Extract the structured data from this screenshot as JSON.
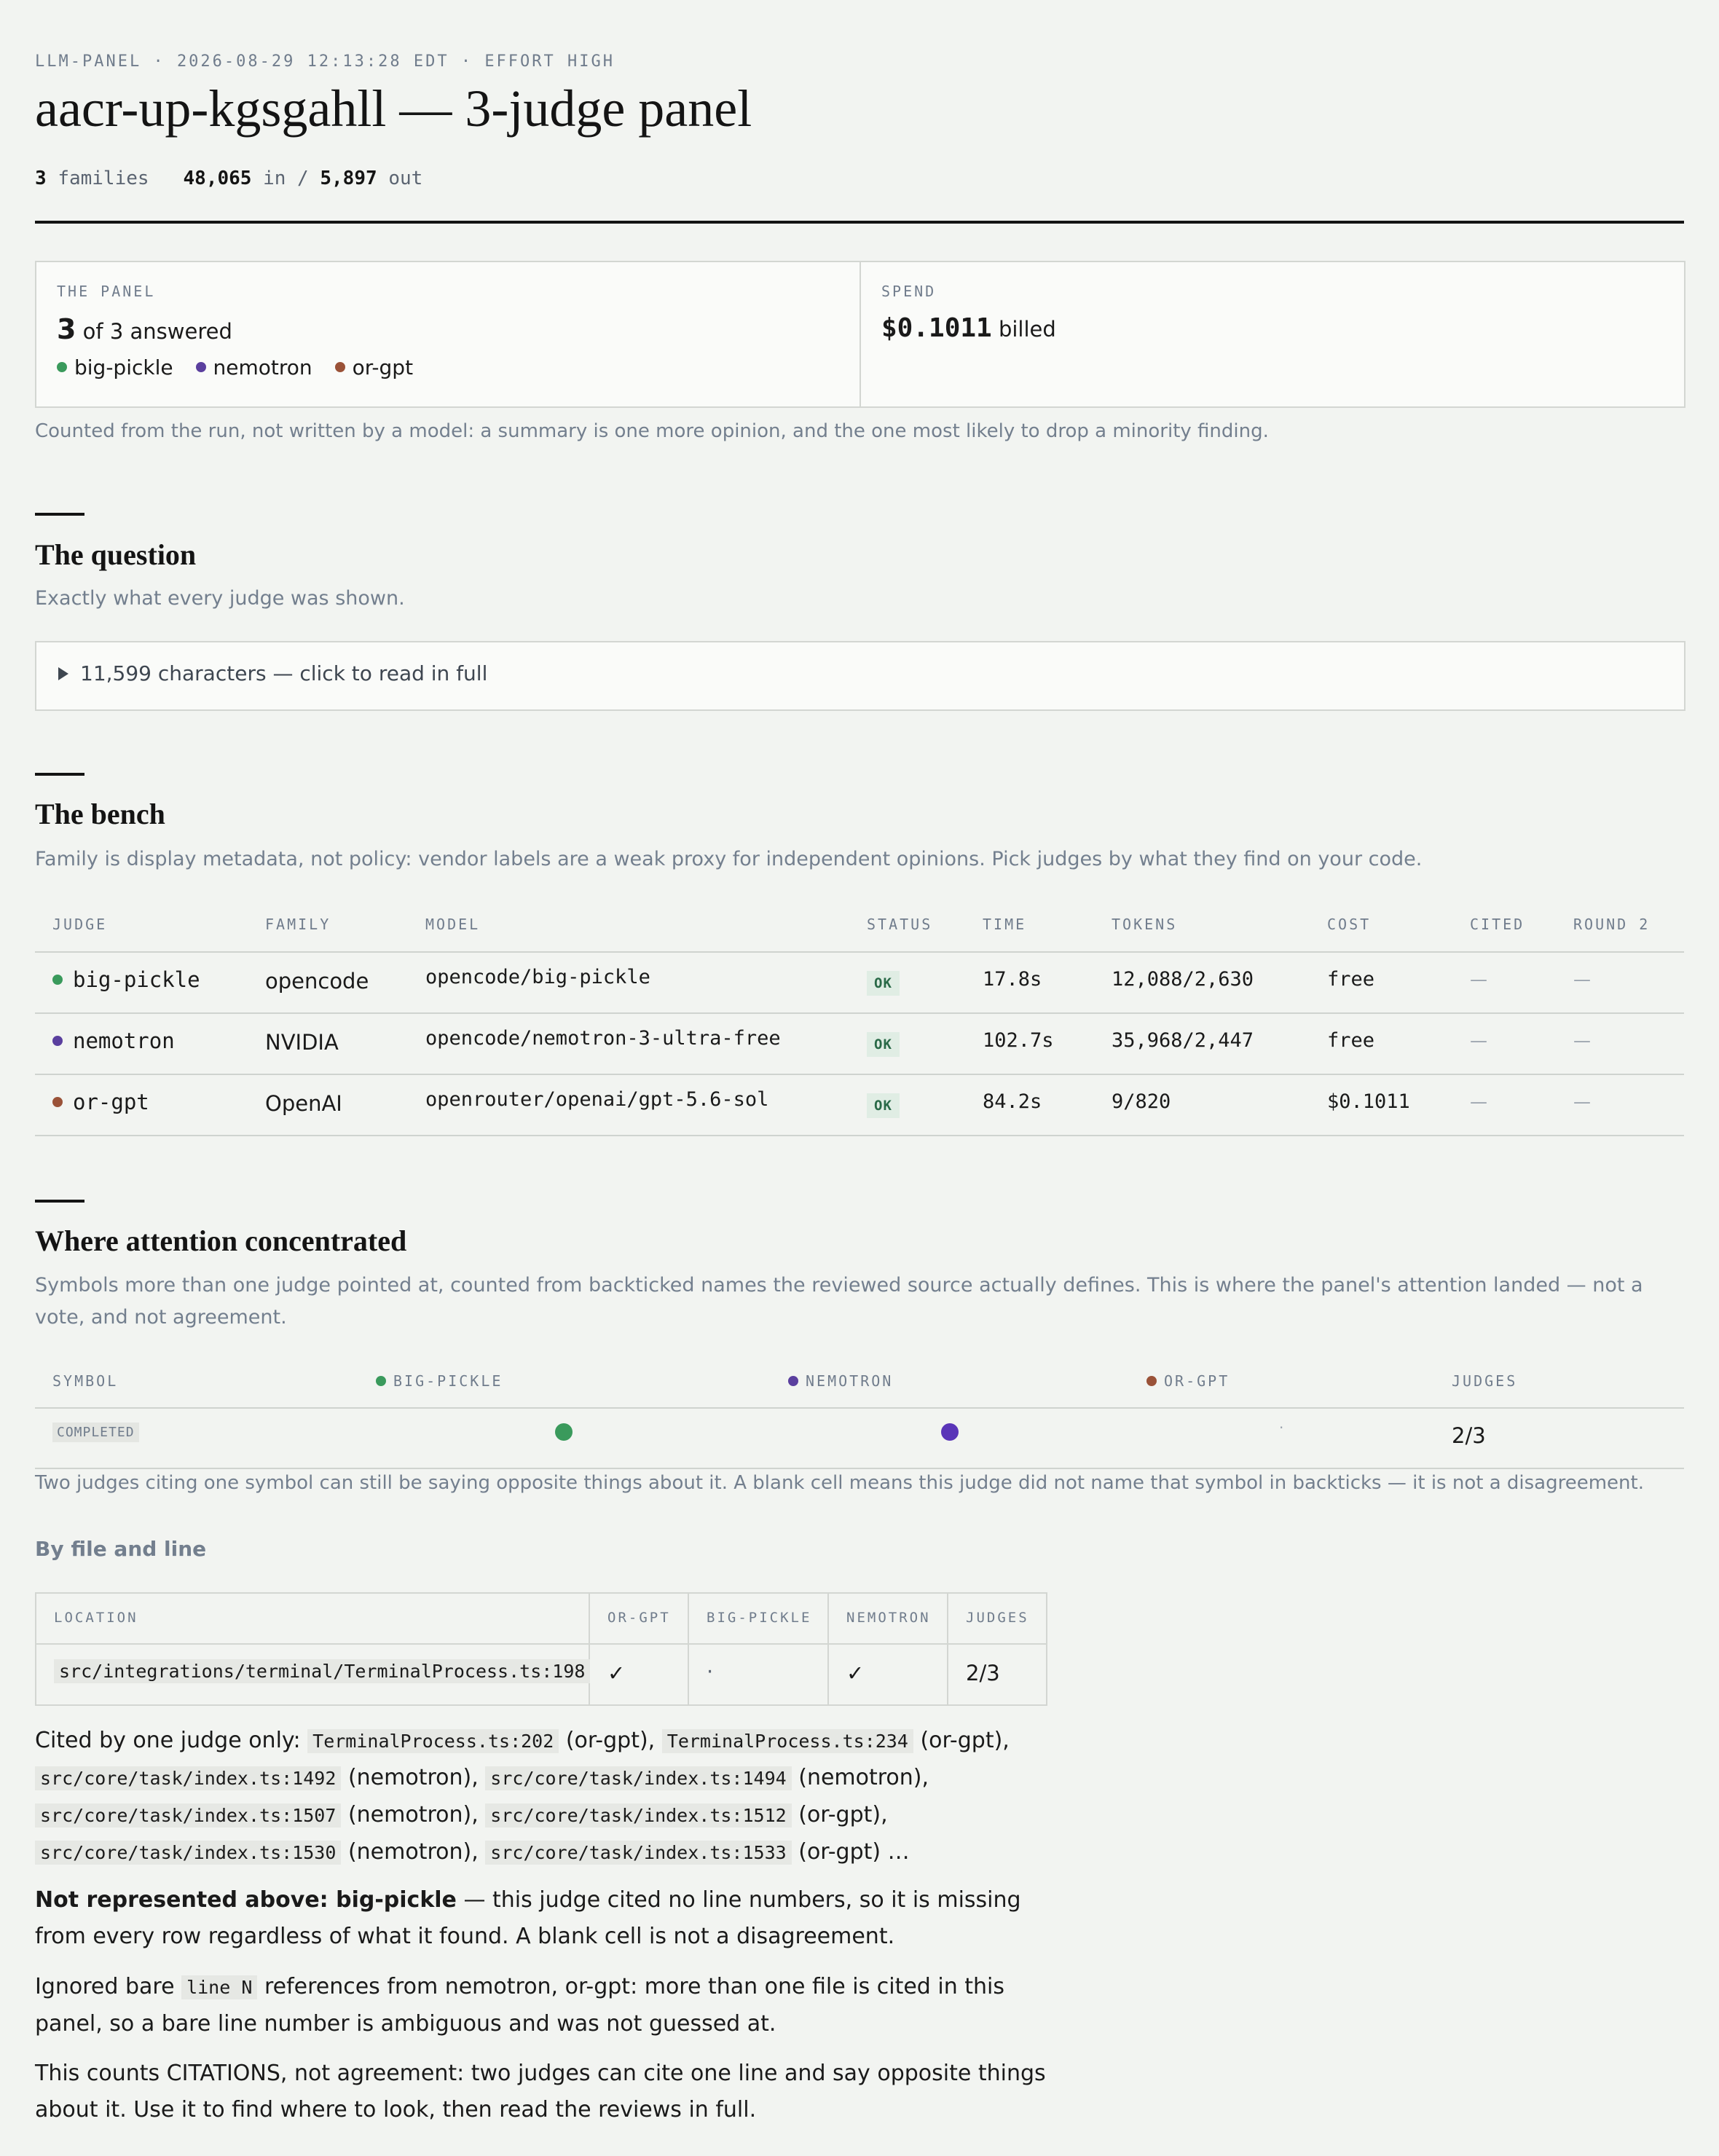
{
  "header": {
    "kicker": "LLM-PANEL · 2026-08-29 12:13:28 EDT · EFFORT HIGH",
    "title": "aacr-up-kgsgahll — 3-judge panel",
    "families_count": "3",
    "families_label": "families",
    "tokens_in": "48,065",
    "in_label": "in /",
    "tokens_out": "5,897",
    "out_label": "out"
  },
  "panel_card": {
    "label": "THE PANEL",
    "answered_count": "3",
    "answered_text": "of 3 answered",
    "judges": [
      {
        "name": "big-pickle",
        "color": "#3a9a5c"
      },
      {
        "name": "nemotron",
        "color": "#5a3f9e"
      },
      {
        "name": "or-gpt",
        "color": "#9a5238"
      }
    ]
  },
  "spend_card": {
    "label": "SPEND",
    "amount": "$0.1011",
    "suffix": "billed"
  },
  "panel_note": "Counted from the run, not written by a model: a summary is one more opinion, and the one most likely to drop a minority finding.",
  "question": {
    "title": "The question",
    "desc": "Exactly what every judge was shown.",
    "toggle": "11,599 characters — click to read in full"
  },
  "bench": {
    "title": "The bench",
    "desc": "Family is display metadata, not policy: vendor labels are a weak proxy for independent opinions. Pick judges by what they find on your code.",
    "columns": [
      "JUDGE",
      "FAMILY",
      "MODEL",
      "STATUS",
      "TIME",
      "TOKENS",
      "COST",
      "CITED",
      "ROUND 2"
    ],
    "rows": [
      {
        "judge": "big-pickle",
        "color": "#3a9a5c",
        "family": "opencode",
        "model": "opencode/big-pickle",
        "status": "OK",
        "time": "17.8s",
        "tokens": "12,088/2,630",
        "cost": "free",
        "cited": "—",
        "round2": "—"
      },
      {
        "judge": "nemotron",
        "color": "#5a3f9e",
        "family": "NVIDIA",
        "model": "opencode/nemotron-3-ultra-free",
        "status": "OK",
        "time": "102.7s",
        "tokens": "35,968/2,447",
        "cost": "free",
        "cited": "—",
        "round2": "—"
      },
      {
        "judge": "or-gpt",
        "color": "#9a5238",
        "family": "OpenAI",
        "model": "openrouter/openai/gpt-5.6-sol",
        "status": "OK",
        "time": "84.2s",
        "tokens": "9/820",
        "cost": "$0.1011",
        "cited": "—",
        "round2": "—"
      }
    ]
  },
  "attention": {
    "title": "Where attention concentrated",
    "desc": "Symbols more than one judge pointed at, counted from backticked names the reviewed source actually defines. This is where the panel's attention landed — not a vote, and not agreement.",
    "columns": [
      "SYMBOL",
      "BIG-PICKLE",
      "NEMOTRON",
      "OR-GPT",
      "JUDGES"
    ],
    "rows": [
      {
        "symbol": "COMPLETED",
        "big_pickle": "dot",
        "nemotron": "dot",
        "or_gpt": "·",
        "judges": "2/3"
      }
    ],
    "note": "Two judges citing one symbol can still be saying opposite things about it. A blank cell means this judge did not name that symbol in backticks — it is not a disagreement."
  },
  "by_file": {
    "title": "By file and line",
    "columns": [
      "LOCATION",
      "OR-GPT",
      "BIG-PICKLE",
      "NEMOTRON",
      "JUDGES"
    ],
    "rows": [
      {
        "location": "src/integrations/terminal/TerminalProcess.ts:198",
        "or_gpt": "✓",
        "big_pickle": "·",
        "nemotron": "✓",
        "judges": "2/3"
      }
    ]
  },
  "cited_one": {
    "lead": "Cited by one judge only:",
    "items": [
      {
        "loc": "TerminalProcess.ts:202",
        "who": "(or-gpt),"
      },
      {
        "loc": "TerminalProcess.ts:234",
        "who": "(or-gpt),"
      },
      {
        "loc": "src/core/task/index.ts:1492",
        "who": "(nemotron),"
      },
      {
        "loc": "src/core/task/index.ts:1494",
        "who": "(nemotron),"
      },
      {
        "loc": "src/core/task/index.ts:1507",
        "who": "(nemotron),"
      },
      {
        "loc": "src/core/task/index.ts:1512",
        "who": "(or-gpt),"
      },
      {
        "loc": "src/core/task/index.ts:1530",
        "who": "(nemotron),"
      },
      {
        "loc": "src/core/task/index.ts:1533",
        "who": "(or-gpt) …"
      }
    ]
  },
  "not_represented": {
    "bold": "Not represented above: big-pickle",
    "text": "— this judge cited no line numbers, so it is missing from every row regardless of what it found. A blank cell is not a disagreement."
  },
  "ignored": {
    "before": "Ignored bare",
    "code": "line N",
    "after": "references from nemotron, or-gpt: more than one file is cited in this panel, so a bare line number is ambiguous and was not guessed at."
  },
  "counts_note": "This counts CITATIONS, not agreement: two judges can cite one line and say opposite things about it. Use it to find where to look, then read the reviews in full."
}
